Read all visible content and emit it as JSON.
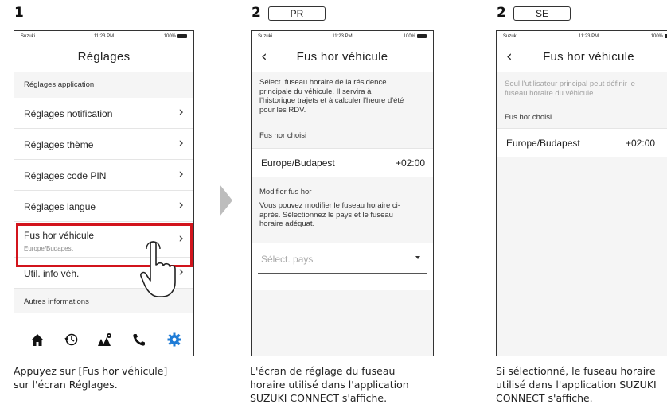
{
  "steps": [
    {
      "number": "1"
    },
    {
      "number": "2",
      "badge": "PR"
    },
    {
      "number": "2",
      "badge": "SE"
    }
  ],
  "status_bar": {
    "carrier": "Suzuki",
    "time": "11:23 PM",
    "battery": "100%"
  },
  "screen1": {
    "title": "Réglages",
    "section_app": "Réglages application",
    "items": [
      {
        "label": "Réglages notification"
      },
      {
        "label": "Réglages thème"
      },
      {
        "label": "Réglages code PIN"
      },
      {
        "label": "Réglages langue"
      },
      {
        "label": "Fus hor véhicule",
        "sub": "Europe/Budapest"
      },
      {
        "label": "Util. info véh."
      }
    ],
    "section_other": "Autres informations",
    "tabs": [
      "home-icon",
      "history-icon",
      "map-icon",
      "phone-icon",
      "settings-icon"
    ],
    "highlight_color": "#d2141c",
    "active_tab_color": "#1e7bd6",
    "caption": [
      "Appuyez sur [Fus hor véhicule]",
      "sur l'écran Réglages."
    ]
  },
  "screen2": {
    "title": "Fus hor véhicule",
    "description": [
      "Sélect. fuseau horaire de la résidence",
      "principale du véhicule. Il servira à",
      "l'historique trajets et à calculer l'heure d'été",
      "pour les RDV."
    ],
    "current_label": "Fus hor choisi",
    "timezone": "Europe/Budapest",
    "offset": "+02:00",
    "modify_label": "Modifier fus hor",
    "modify_text": [
      "Vous pouvez modifier le fuseau horaire ci-",
      "après. Sélectionnez le pays et le fuseau",
      "horaire adéquat."
    ],
    "country_placeholder": "Sélect. pays",
    "caption": [
      "L'écran de réglage du fuseau",
      "horaire utilisé dans l'application",
      "SUZUKI CONNECT s'affiche."
    ]
  },
  "screen3": {
    "title": "Fus hor véhicule",
    "notice": [
      "Seul l'utilisateur principal peut définir le",
      "fuseau horaire du véhicule."
    ],
    "current_label": "Fus hor choisi",
    "timezone": "Europe/Budapest",
    "offset": "+02:00",
    "caption": [
      "Si sélectionné, le fuseau horaire",
      "utilisé dans l'application SUZUKI",
      "CONNECT s'affiche."
    ]
  }
}
